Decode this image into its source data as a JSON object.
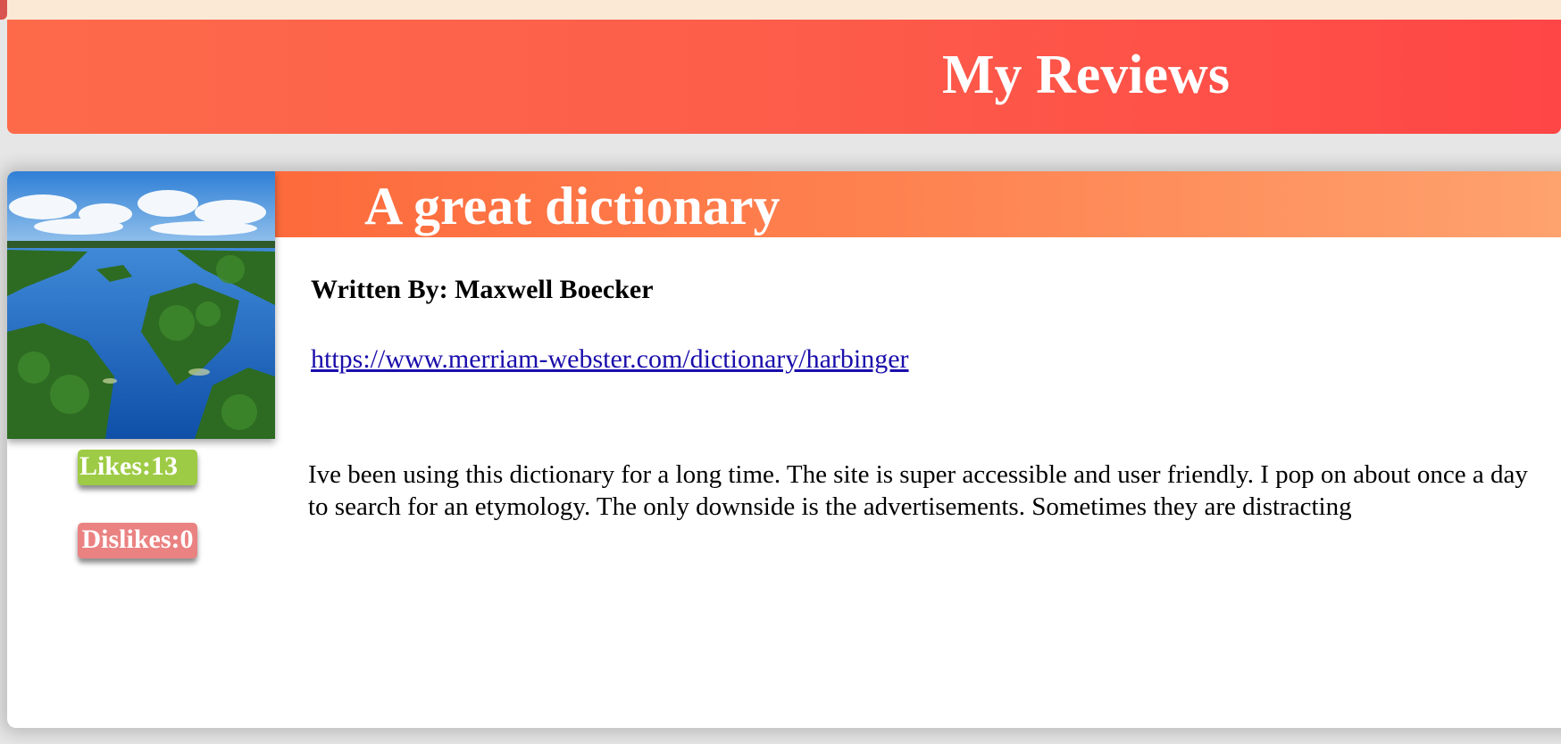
{
  "header": {
    "title": "My Reviews"
  },
  "review": {
    "title": "A great dictionary",
    "author_line": "Written By: Maxwell Boecker",
    "link": "https://www.merriam-webster.com/dictionary/harbinger",
    "body": "Ive been using this dictionary for a long time. The site is super accessible and user friendly. I pop on about once a day to search for an etymology. The only downside is the advertisements. Sometimes they are distracting",
    "likes_label": "Likes:13",
    "dislikes_label": "Dislikes:0",
    "image": "lake-islands-aerial-photo"
  },
  "colors": {
    "header_gradient": [
      "#fd6a4a",
      "#fe4646"
    ],
    "title_gradient": [
      "#fd6a3c",
      "#fea36f"
    ],
    "likes": "#9ecb45",
    "dislikes": "#eb8282",
    "link": "#1a0dab"
  }
}
